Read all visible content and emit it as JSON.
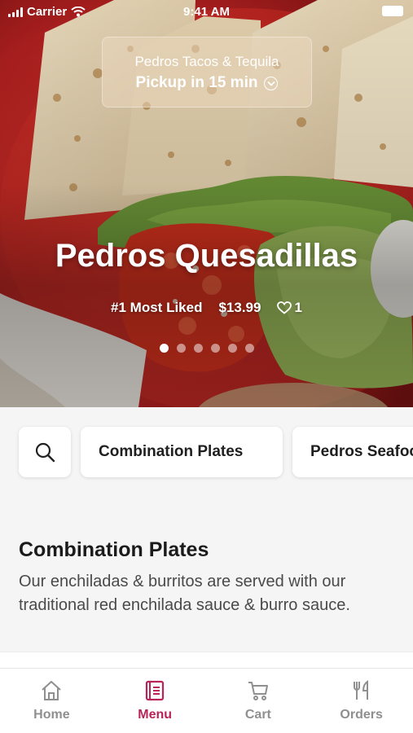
{
  "status_bar": {
    "carrier": "Carrier",
    "time": "9:41 AM"
  },
  "store": {
    "name": "Pedros Tacos & Tequila",
    "pickup": "Pickup in 15 min"
  },
  "featured": {
    "title": "Pedros Quesadillas",
    "rank": "#1 Most Liked",
    "price": "$13.99",
    "likes": "1",
    "slide_count": 6,
    "active_slide": 1
  },
  "categories": [
    "Combination Plates",
    "Pedros Seafood"
  ],
  "section": {
    "title": "Combination Plates",
    "description": "Our enchiladas & burritos are served with our traditional red enchilada sauce & burro sauce."
  },
  "tabs": [
    {
      "label": "Home",
      "icon": "home-icon"
    },
    {
      "label": "Menu",
      "icon": "menu-icon"
    },
    {
      "label": "Cart",
      "icon": "cart-icon"
    },
    {
      "label": "Orders",
      "icon": "utensils-icon"
    }
  ],
  "colors": {
    "accent": "#b8245a",
    "inactive": "#8f8f8f"
  }
}
